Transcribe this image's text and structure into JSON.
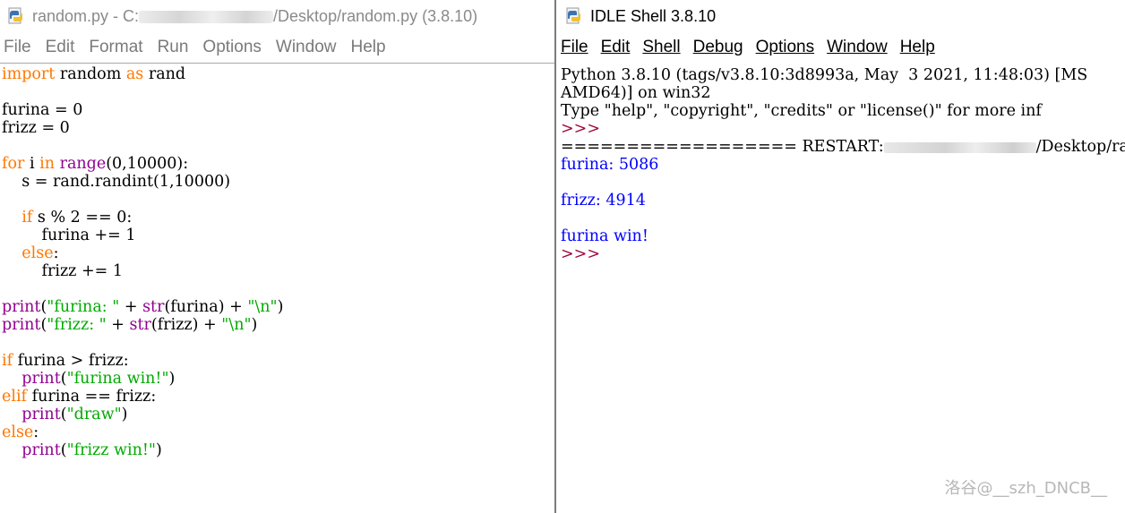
{
  "editor": {
    "title_prefix": "random.py - C:",
    "title_suffix": "/Desktop/random.py (3.8.10)",
    "menu": [
      "File",
      "Edit",
      "Format",
      "Run",
      "Options",
      "Window",
      "Help"
    ],
    "code_lines": [
      "import random as rand",
      "",
      "furina = 0",
      "frizz = 0",
      "",
      "for i in range(0,10000):",
      "    s = rand.randint(1,10000)",
      "",
      "    if s % 2 == 0:",
      "        furina += 1",
      "    else:",
      "        frizz += 1",
      "",
      "print(\"furina: \" + str(furina) + \"\\n\")",
      "print(\"frizz: \" + str(frizz) + \"\\n\")",
      "",
      "if furina > frizz:",
      "    print(\"furina win!\")",
      "elif furina == frizz:",
      "    print(\"draw\")",
      "else:",
      "    print(\"frizz win!\")"
    ]
  },
  "shell": {
    "title": "IDLE Shell 3.8.10",
    "menu": [
      "File",
      "Edit",
      "Shell",
      "Debug",
      "Options",
      "Window",
      "Help"
    ],
    "banner_line1": "Python 3.8.10 (tags/v3.8.10:3d8993a, May  3 2021, 11:48:03) [MS",
    "banner_line2": "AMD64)] on win32",
    "banner_line3": "Type \"help\", \"copyright\", \"credits\" or \"license()\" for more inf",
    "prompt": ">>>",
    "restart_prefix": "================== RESTART:",
    "restart_suffix": "/Desktop/random.py",
    "output_furina": "furina: 5086",
    "output_frizz": "frizz: 4914",
    "output_result": "furina win!"
  },
  "watermark": "洛谷@__szh_DNCB__"
}
